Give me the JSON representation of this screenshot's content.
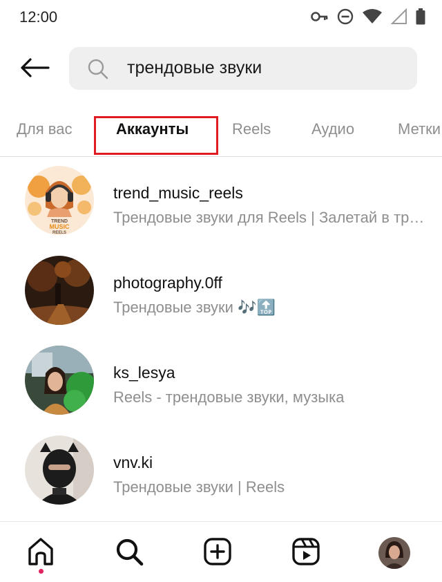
{
  "status_bar": {
    "time": "12:00",
    "icons": [
      "vpn-key-icon",
      "do-not-disturb-icon",
      "wifi-icon",
      "cell-signal-icon",
      "battery-icon"
    ]
  },
  "search": {
    "query": "трендовые звуки",
    "icon": "search-icon",
    "back_icon": "back-arrow-icon"
  },
  "tabs": [
    {
      "label": "Для вас",
      "active": false
    },
    {
      "label": "Аккаунты",
      "active": true
    },
    {
      "label": "Reels",
      "active": false
    },
    {
      "label": "Аудио",
      "active": false
    },
    {
      "label": "Метки",
      "active": false
    }
  ],
  "avatar_badge": {
    "line1": "TREND",
    "line2": "MUSIC",
    "line3": "REELS"
  },
  "accounts": [
    {
      "username": "trend_music_reels",
      "subtitle": "Трендовые звуки для Reels | Залетай в тренды"
    },
    {
      "username": "photography.0ff",
      "subtitle": "Трендовые звуки 🎶🔝"
    },
    {
      "username": "ks_lesya",
      "subtitle": "Reels - трендовые звуки, музыка"
    },
    {
      "username": "vnv.ki",
      "subtitle": "Трендовые звуки | Reels"
    }
  ],
  "bottom_nav": {
    "items": [
      "home-icon",
      "search-icon",
      "create-post-icon",
      "reels-icon",
      "profile-avatar"
    ],
    "active": "home-icon"
  },
  "colors": {
    "highlight_box": "#e11b22",
    "muted_text": "#8e8e8e",
    "search_bg": "#efefef",
    "notification_dot": "#e0245e"
  }
}
